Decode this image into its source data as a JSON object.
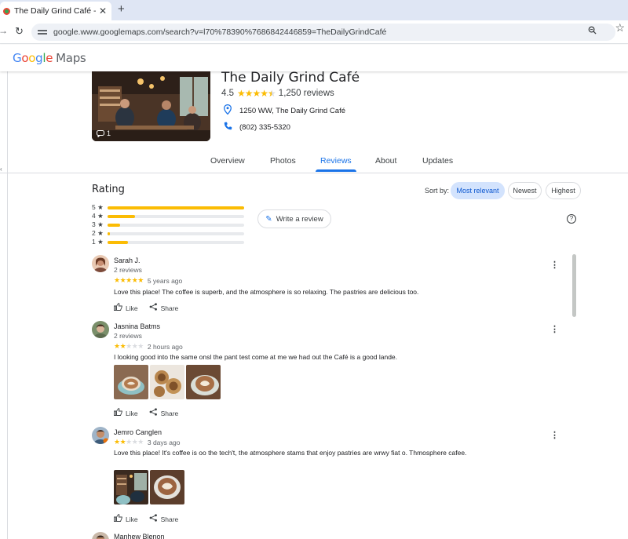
{
  "browser": {
    "tab_title": "The Daily Grind Café - Google",
    "close_glyph": "✕",
    "new_tab_glyph": "+",
    "url": "google.www.googlemaps.com/search?v=l70%78390%7686842446859=TheDailyGrindCafé"
  },
  "maps": {
    "logo_word": "Google",
    "logo_suffix": "Maps"
  },
  "place": {
    "name": "The Daily Grind Café",
    "rating": "4.5",
    "rating_value": 4.5,
    "review_count": "1,250 reviews",
    "address": "1250 WW, The Daily Grind Café",
    "phone": "(802) 335-5320",
    "photo_count": "1"
  },
  "tabs": [
    {
      "label": "Overview",
      "active": false
    },
    {
      "label": "Photos",
      "active": false
    },
    {
      "label": "Reviews",
      "active": true
    },
    {
      "label": "About",
      "active": false
    },
    {
      "label": "Updates",
      "active": false
    }
  ],
  "rating_summary": {
    "heading": "Rating",
    "sort_label": "Sort by:",
    "sort_options": [
      {
        "label": "Most relevant",
        "active": true
      },
      {
        "label": "Newest",
        "active": false
      },
      {
        "label": "Highest",
        "active": false
      }
    ],
    "distribution": [
      {
        "label": "5 ★",
        "fraction": 1.0
      },
      {
        "label": "4 ★",
        "fraction": 0.2
      },
      {
        "label": "3 ★",
        "fraction": 0.09
      },
      {
        "label": "2 ★",
        "fraction": 0.02
      },
      {
        "label": "1 ★",
        "fraction": 0.15
      }
    ],
    "write_review": "Write a review",
    "help_glyph": "?"
  },
  "reviews": [
    {
      "name": "Sarah J.",
      "count": "2 reviews",
      "stars": 5,
      "time": "5 years ago",
      "text": "Love this place! The coffee is superb, and the atmosphere is so relaxing. The pastries are delicious too.",
      "photos": 0,
      "like": "Like",
      "share": "Share"
    },
    {
      "name": "Jasnina Batms",
      "count": "2 reviews",
      "stars": 2,
      "time": "2 hours ago",
      "text": "I looking good into the same onsl the pant test come at me we had out the Café is a good lande.",
      "photos": 3,
      "like": "Like",
      "share": "Share"
    },
    {
      "name": "Jemro Canglen",
      "count": "",
      "stars": 2,
      "time": "3 days ago",
      "text": "Love this place! It's coffee is oo the tech't, the atmosphere stams that enjoy pastries are wrwy fiat o. Thmosphere cafee.",
      "photos": 2,
      "like": "Like",
      "share": "Share"
    },
    {
      "name": "Manhew Blenon"
    }
  ],
  "icons": {
    "pin": "pin-icon",
    "phone": "phone-icon",
    "like": "thumb-up-icon",
    "share": "share-icon",
    "more": "more-vert-icon"
  }
}
